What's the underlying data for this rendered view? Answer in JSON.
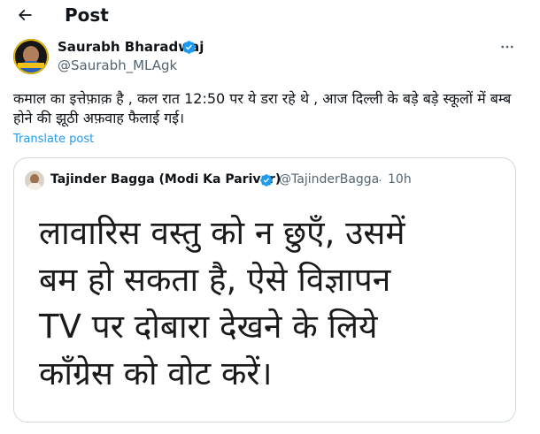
{
  "header": {
    "title": "Post",
    "back_icon": "arrow-left-icon"
  },
  "post": {
    "author_name": "Saurabh Bharadwaj",
    "author_handle": "@Saurabh_MLAgk",
    "text": "कमाल का इत्तेफ़ाक़ है , कल रात 12:50 पर ये डरा रहे थे , आज दिल्ली के बड़े बड़े स्कूलों में बम्ब होने की झूठी अफ़वाह फैलाई गई।",
    "translate_label": "Translate post",
    "more_icon": "more-horizontal-icon"
  },
  "quote": {
    "author_name": "Tajinder Bagga (Modi Ka Parivar)",
    "author_handle": "@TajinderBagga",
    "separator": "·",
    "time": "10h",
    "image_lines": [
      "लावारिस वस्तु को न छुएँ, उसमें",
      "बम हो सकता है, ऐसे विज्ञापन",
      "TV पर दोबारा देखने के लिये",
      "कॉंग्रेस को वोट करें।"
    ]
  },
  "colors": {
    "verified": "#1d9bf0",
    "link": "#1d9bf0",
    "secondary_text": "#536471",
    "border": "#cfd9de"
  }
}
